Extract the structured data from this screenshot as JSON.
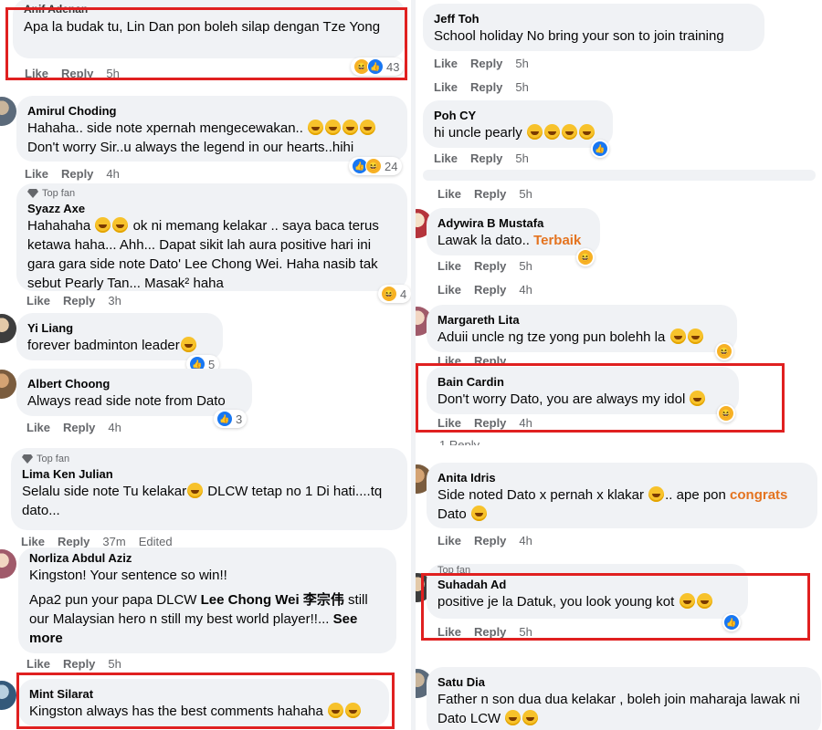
{
  "left": {
    "c1": {
      "name": "Anif Adenan",
      "text": "Apa la budak tu, Lin Dan pon boleh silap dengan Tze Yong",
      "like": "Like",
      "reply": "Reply",
      "time": "5h",
      "react_count": "43"
    },
    "c2": {
      "name": "Amirul Choding",
      "text1": "Hahaha.. side note xpernah mengecewakan..",
      "text2": "Don't worry Sir..u always the legend in our hearts..hihi",
      "like": "Like",
      "reply": "Reply",
      "time": "4h",
      "react_count": "24"
    },
    "c3": {
      "badge": "Top fan",
      "name": "Syazz Axe",
      "text1": "Hahahaha",
      "text2": "ok ni memang kelakar .. saya baca terus ketawa haha... Ahh... Dapat sikit lah aura positive hari ini gara gara side note Dato' Lee Chong Wei. Haha nasib tak sebut Pearly Tan... Masak² haha",
      "like": "Like",
      "reply": "Reply",
      "time": "3h",
      "react_count": "4"
    },
    "c4": {
      "name": "Yi Liang",
      "text": "forever badminton leader",
      "like": "Like",
      "reply": "Reply",
      "time": "4h",
      "react_count": "5"
    },
    "c5": {
      "name": "Albert Choong",
      "text": "Always read side note from Dato",
      "like": "Like",
      "reply": "Reply",
      "time": "4h",
      "react_count": "3"
    },
    "c6": {
      "badge": "Top fan",
      "name": "Lima Ken Julian",
      "text1": "Selalu side note Tu kelakar",
      "text2": "DLCW tetap no 1 Di hati....tq dato...",
      "like": "Like",
      "reply": "Reply",
      "time": "37m",
      "edited": "Edited"
    },
    "c7": {
      "name": "Norliza Abdul Aziz",
      "text1": "Kingston! Your sentence so win!!",
      "text2a": "Apa2 pun your papa DLCW ",
      "text2b": "Lee Chong Wei 李宗伟",
      "text2c": " still our Malaysian hero n still my best world player!!... ",
      "see_more": "See more",
      "like": "Like",
      "reply": "Reply",
      "time": "5h"
    },
    "c8": {
      "name": "Mint Silarat",
      "text": "Kingston always has the best comments hahaha"
    }
  },
  "right": {
    "c1": {
      "name": "Jeff Toh",
      "text": "School holiday No bring your son to join training",
      "like": "Like",
      "reply": "Reply",
      "time": "5h"
    },
    "c1b": {
      "like": "Like",
      "reply": "Reply",
      "time": "5h"
    },
    "c2": {
      "name": "Poh CY",
      "text": "hi uncle pearly",
      "like": "Like",
      "reply": "Reply",
      "time": "5h"
    },
    "c2b": {
      "like": "Like",
      "reply": "Reply",
      "time": "5h"
    },
    "c3": {
      "name": "Adywira B Mustafa",
      "text": "Lawak la dato.. ",
      "highlight": "Terbaik",
      "like": "Like",
      "reply": "Reply",
      "time": "5h"
    },
    "c3b": {
      "like": "Like",
      "reply": "Reply",
      "time": "4h"
    },
    "c4": {
      "name": "Margareth Lita",
      "text": "Aduii uncle ng tze yong pun bolehh la",
      "like": "Like",
      "reply": "Reply"
    },
    "c5": {
      "name": "Bain Cardin",
      "text": "Don't worry Dato, you are always my idol",
      "like": "Like",
      "reply": "Reply",
      "time": "4h",
      "replies": "1 Reply"
    },
    "c6": {
      "name": "Anita Idris",
      "text1": "Side noted Dato x pernah x klakar",
      "text2": ".. ape pon ",
      "highlight": "congrats",
      "text3": "Dato",
      "like": "Like",
      "reply": "Reply",
      "time": "4h"
    },
    "c7": {
      "badge": "Top fan",
      "name": "Suhadah Ad",
      "text": "positive je la Datuk, you look young kot",
      "like": "Like",
      "reply": "Reply",
      "time": "5h"
    },
    "c8": {
      "name": "Satu Dia",
      "text": "Father n son dua dua kelakar , boleh join maharaja lawak ni Dato LCW"
    }
  },
  "colors": {
    "highlight_frame": "#e02020",
    "bubble": "#f0f2f5",
    "like_blue": "#1877f2",
    "name_accent": "#e4731f"
  }
}
